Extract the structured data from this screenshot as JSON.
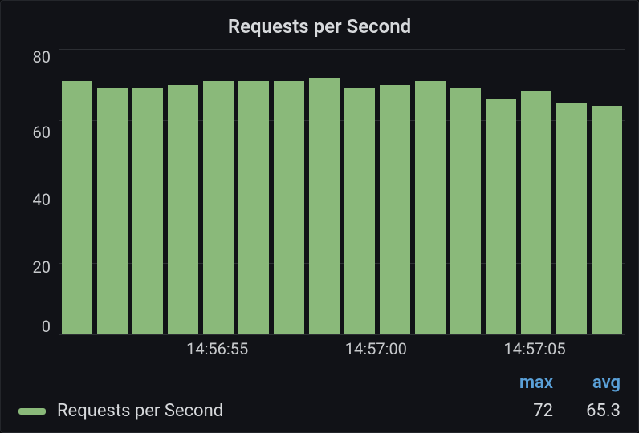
{
  "chart_data": {
    "type": "bar",
    "title": "Requests per Second",
    "ylabel": "",
    "xlabel": "",
    "ylim": [
      0,
      80
    ],
    "y_ticks": [
      80,
      60,
      40,
      20,
      0
    ],
    "x_ticks": [
      {
        "label": "14:56:55",
        "pos": 0.28
      },
      {
        "label": "14:57:00",
        "pos": 0.56
      },
      {
        "label": "14:57:05",
        "pos": 0.84
      }
    ],
    "v_gridlines": [
      0.28,
      0.56,
      0.84
    ],
    "series": [
      {
        "name": "Requests per Second",
        "color": "#8ab97a",
        "values": [
          71,
          69,
          69,
          70,
          71,
          71,
          71,
          72,
          69,
          70,
          71,
          69,
          66,
          68,
          65,
          64
        ]
      }
    ]
  },
  "stats": {
    "headers": {
      "max": "max",
      "avg": "avg"
    },
    "legend_label": "Requests per Second",
    "max": "72",
    "avg": "65.3"
  },
  "accent_color": "#8ab97a"
}
